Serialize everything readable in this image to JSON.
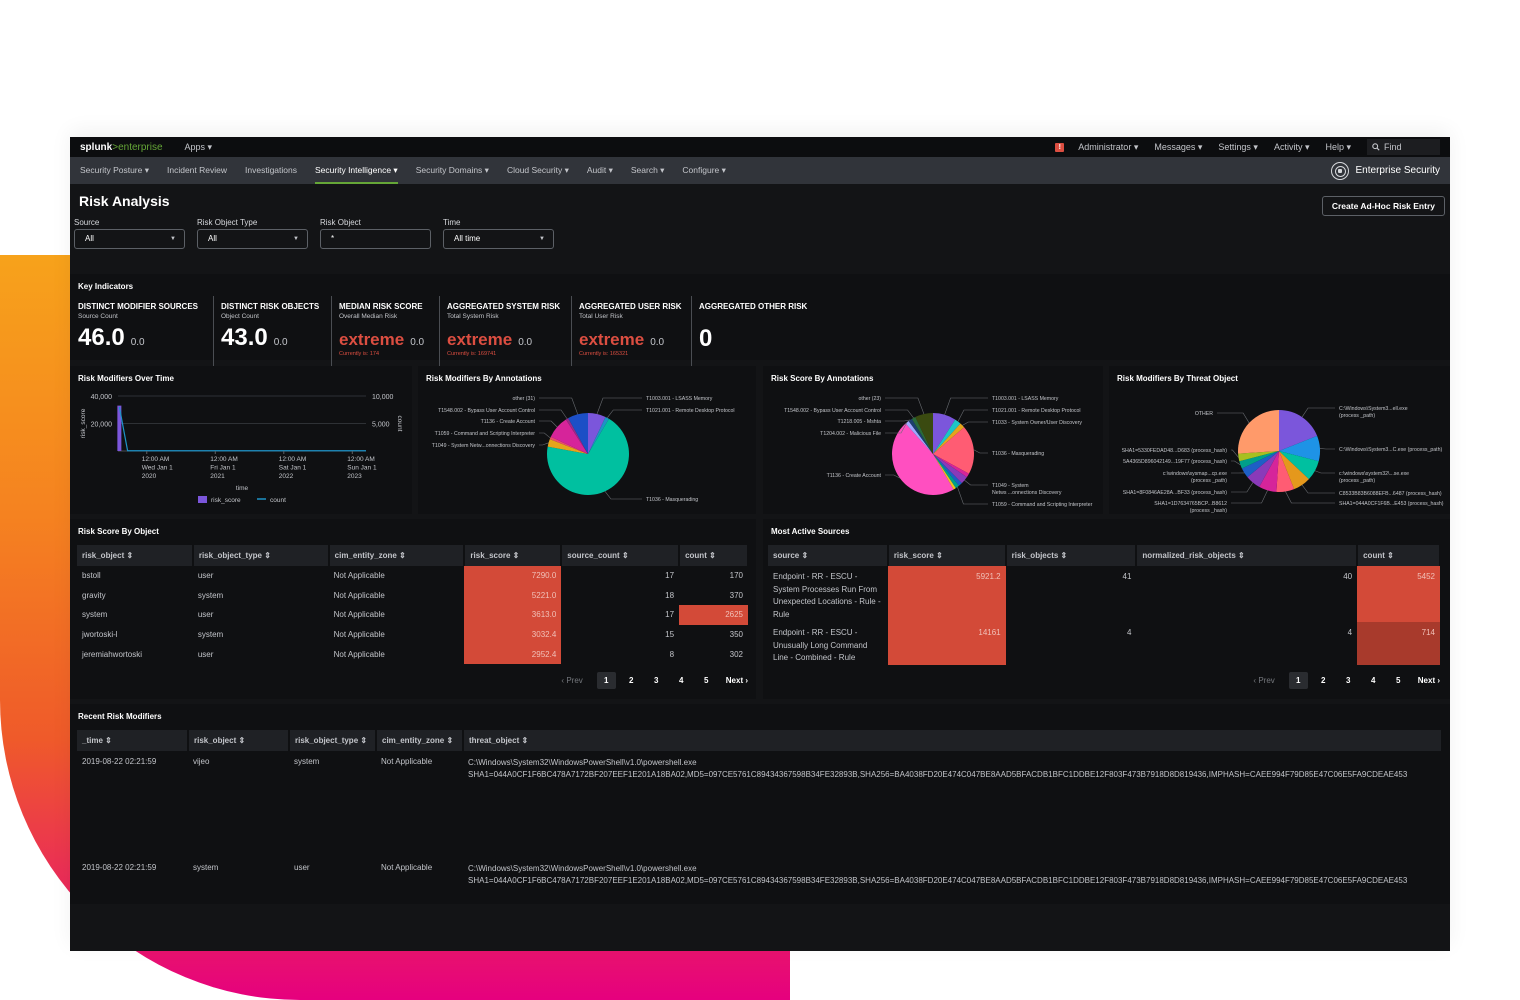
{
  "topbar": {
    "logo_main": "splunk",
    "logo_sep": ">",
    "logo_sub": "enterprise",
    "apps_label": "Apps ▾",
    "alert_badge": "!",
    "menu": [
      "Administrator ▾",
      "Messages ▾",
      "Settings ▾",
      "Activity ▾",
      "Help ▾"
    ],
    "find_placeholder": "Find"
  },
  "nav": {
    "items": [
      {
        "label": "Security Posture ▾",
        "active": false
      },
      {
        "label": "Incident Review",
        "active": false
      },
      {
        "label": "Investigations",
        "active": false
      },
      {
        "label": "Security Intelligence ▾",
        "active": true
      },
      {
        "label": "Security Domains ▾",
        "active": false
      },
      {
        "label": "Cloud Security ▾",
        "active": false
      },
      {
        "label": "Audit ▾",
        "active": false
      },
      {
        "label": "Search ▾",
        "active": false
      },
      {
        "label": "Configure ▾",
        "active": false
      }
    ],
    "brand": "Enterprise Security"
  },
  "page": {
    "title": "Risk Analysis",
    "adhoc_button": "Create Ad-Hoc Risk Entry"
  },
  "filters": [
    {
      "label": "Source",
      "value": "All",
      "type": "dropdown"
    },
    {
      "label": "Risk Object Type",
      "value": "All",
      "type": "dropdown"
    },
    {
      "label": "Risk Object",
      "value": "*",
      "type": "text"
    },
    {
      "label": "Time",
      "value": "All time",
      "type": "dropdown"
    }
  ],
  "key_indicators": {
    "title": "Key Indicators",
    "items": [
      {
        "title": "DISTINCT MODIFIER SOURCES",
        "subtitle": "Source Count",
        "value": "46.0",
        "delta": "0.0",
        "current": "",
        "severity": false
      },
      {
        "title": "DISTINCT RISK OBJECTS",
        "subtitle": "Object Count",
        "value": "43.0",
        "delta": "0.0",
        "current": "",
        "severity": false
      },
      {
        "title": "MEDIAN RISK SCORE",
        "subtitle": "Overall Median Risk",
        "value": "extreme",
        "delta": "0.0",
        "current": "Currently is: 174",
        "severity": true
      },
      {
        "title": "AGGREGATED SYSTEM RISK",
        "subtitle": "Total System Risk",
        "value": "extreme",
        "delta": "0.0",
        "current": "Currently is: 169741",
        "severity": true
      },
      {
        "title": "AGGREGATED USER RISK",
        "subtitle": "Total User Risk",
        "value": "extreme",
        "delta": "0.0",
        "current": "Currently is: 165321",
        "severity": true
      },
      {
        "title": "AGGREGATED OTHER RISK",
        "subtitle": "",
        "value": "0",
        "delta": "",
        "current": "",
        "severity": false
      }
    ]
  },
  "colors": {
    "accent_green": "#65a637",
    "severity_red": "#dc4e41",
    "heat_cell": "#d34a38",
    "risk_score_bar": "#7b56db",
    "count_line": "#1e93c6"
  },
  "chart_data": [
    {
      "type": "bar",
      "title": "Risk Modifiers Over Time",
      "xlabel": "time",
      "ylabel": "risk_score",
      "y2label": "count",
      "ylim": [
        0,
        40000
      ],
      "y2lim": [
        0,
        10000
      ],
      "yticks": [
        "40,000",
        "20,000"
      ],
      "y2ticks": [
        "10,000",
        "5,000"
      ],
      "xticks": [
        {
          "line1": "12:00 AM",
          "line2": "Wed Jan 1",
          "line3": "2020"
        },
        {
          "line1": "12:00 AM",
          "line2": "Fri Jan 1",
          "line3": "2021"
        },
        {
          "line1": "12:00 AM",
          "line2": "Sat Jan 1",
          "line3": "2022"
        },
        {
          "line1": "12:00 AM",
          "line2": "Sun Jan 1",
          "line3": "2023"
        }
      ],
      "series": [
        {
          "name": "risk_score",
          "kind": "bar",
          "x": [
            2019.6
          ],
          "values": [
            33000
          ]
        },
        {
          "name": "count",
          "kind": "line",
          "x": [
            2019.6,
            2019.72,
            2023.2
          ],
          "values": [
            8000,
            50,
            50
          ]
        }
      ],
      "xrange": [
        2019.58,
        2023.2
      ],
      "legend": [
        "risk_score",
        "count"
      ],
      "legend_position": "bottom",
      "grid": true
    },
    {
      "type": "pie",
      "title": "Risk Modifiers By Annotations",
      "slices": [
        {
          "label": "T1003.001 - LSASS Memory",
          "value": 7,
          "color": "#7b56db"
        },
        {
          "label": "T1021.001 - Remote Desktop Protocol",
          "value": 1.5,
          "color": "#1e93c6"
        },
        {
          "label": "T1036 - Masquerading",
          "value": 69,
          "color": "#00c0a0"
        },
        {
          "label": "T1049 - System Netw...onnections Discovery",
          "value": 3,
          "color": "#e5a51c"
        },
        {
          "label": "T1059 - Command and Scripting Interpreter",
          "value": 1,
          "color": "#ea4b6f"
        },
        {
          "label": "T1136 - Create Account",
          "value": 9,
          "color": "#d6249a"
        },
        {
          "label": "T1548.002 - Bypass User Account Control",
          "value": 1,
          "color": "#9b2a8a"
        },
        {
          "label": "other (31)",
          "value": 8,
          "color": "#1c4fc6"
        }
      ]
    },
    {
      "type": "pie",
      "title": "Risk Score By Annotations",
      "slices": [
        {
          "label": "T1003.001 - LSASS Memory",
          "value": 9,
          "color": "#7b56db"
        },
        {
          "label": "T1021.001 - Remote Desktop Protocol",
          "value": 2.5,
          "color": "#1cc6c6"
        },
        {
          "label": "T1033 - System Owner/User Discovery",
          "value": 2,
          "color": "#e5a51c"
        },
        {
          "label": "T1036 - Masquerading",
          "value": 19,
          "color": "#ff5c73"
        },
        {
          "label": "",
          "value": 1.5,
          "color": "#d6249a"
        },
        {
          "label": "T1049 - System Netws...onnections Discovery",
          "value": 3,
          "color": "#8a3ab9"
        },
        {
          "label": "",
          "value": 1.5,
          "color": "#1e5fc6"
        },
        {
          "label": "T1059 - Command and Scripting Interpreter",
          "value": 1.5,
          "color": "#00a08a"
        },
        {
          "label": "",
          "value": 1,
          "color": "#f0c020"
        },
        {
          "label": "T1136 - Create Account",
          "value": 46,
          "color": "#ff4fc0"
        },
        {
          "label": "T1204.002 - Malicious File",
          "value": 1.5,
          "color": "#9fa8ff"
        },
        {
          "label": "T1218.005 - Mshta",
          "value": 1.5,
          "color": "#1c3f6e"
        },
        {
          "label": "T1548.002 - Bypass User Account Control",
          "value": 1.5,
          "color": "#2a6a3a"
        },
        {
          "label": "other (23)",
          "value": 7,
          "color": "#3a4a10"
        }
      ]
    },
    {
      "type": "pie",
      "title": "Risk Modifiers By Threat Object",
      "slices": [
        {
          "label": "C:\\Windows\\System3...ell.exe (process_path)",
          "value": 19,
          "color": "#7b56db"
        },
        {
          "label": "C:\\Windows\\System3...C.exe (process_path)",
          "value": 10,
          "color": "#1e93e6"
        },
        {
          "label": "c:\\windows\\system32\\...se.exe (process_path)",
          "value": 8,
          "color": "#00c0a0"
        },
        {
          "label": "C8533B83B6088EFB...6487 (process_hash)",
          "value": 7,
          "color": "#e5981c"
        },
        {
          "label": "SHA1=044A0CF1F6B...E453 (process_hash)",
          "value": 7,
          "color": "#ff5c73"
        },
        {
          "label": "SHA1=1D7634765BCP...B8612 (process_hash)",
          "value": 7,
          "color": "#d6249a"
        },
        {
          "label": "SHA1=8F0846AE28A...BF33 (process_hash)",
          "value": 6,
          "color": "#8a3ab9"
        },
        {
          "label": "c:\\windows\\sysmap...cp.exe (process_path)",
          "value": 4,
          "color": "#1e5fc6"
        },
        {
          "label": "5A4365D896042149...19F77 (process_hash)",
          "value": 3,
          "color": "#00a08a"
        },
        {
          "label": "SHA1=5330FEDAD48...D683 (process_hash)",
          "value": 3,
          "color": "#a8c020"
        },
        {
          "label": "OTHER",
          "value": 26,
          "color": "#ff9a6a"
        }
      ]
    }
  ],
  "risk_score_by_object": {
    "title": "Risk Score By Object",
    "columns": [
      "risk_object ⇕",
      "risk_object_type ⇕",
      "cim_entity_zone ⇕",
      "risk_score ⇕",
      "source_count ⇕",
      "count ⇕"
    ],
    "rows": [
      [
        "bstoll",
        "user",
        "Not Applicable",
        "7290.0",
        "17",
        "170"
      ],
      [
        "gravity",
        "system",
        "Not Applicable",
        "5221.0",
        "18",
        "370"
      ],
      [
        "system",
        "user",
        "Not Applicable",
        "3613.0",
        "17",
        "2625"
      ],
      [
        "jwortoski-l",
        "system",
        "Not Applicable",
        "3032.4",
        "15",
        "350"
      ],
      [
        "jeremiahwortoski",
        "user",
        "Not Applicable",
        "2952.4",
        "8",
        "302"
      ]
    ],
    "pager": {
      "prev": "Prev",
      "pages": [
        "1",
        "2",
        "3",
        "4",
        "5"
      ],
      "current": "1",
      "next": "Next"
    }
  },
  "most_active_sources": {
    "title": "Most Active Sources",
    "columns": [
      "source ⇕",
      "risk_score ⇕",
      "risk_objects ⇕",
      "normalized_risk_objects ⇕",
      "count ⇕"
    ],
    "rows": [
      [
        "Endpoint - RR - ESCU - System Processes Run From Unexpected Locations - Rule - Rule",
        "5921.2",
        "41",
        "40",
        "5452"
      ],
      [
        "Endpoint - RR - ESCU - Unusually Long Command Line - Combined - Rule",
        "14161",
        "4",
        "4",
        "714"
      ]
    ],
    "pager": {
      "prev": "Prev",
      "pages": [
        "1",
        "2",
        "3",
        "4",
        "5"
      ],
      "current": "1",
      "next": "Next"
    }
  },
  "recent_risk_modifiers": {
    "title": "Recent Risk Modifiers",
    "columns": [
      "_time ⇕",
      "risk_object ⇕",
      "risk_object_type ⇕",
      "cim_entity_zone ⇕",
      "threat_object ⇕"
    ],
    "rows": [
      {
        "time": "2019-08-22 02:21:59",
        "risk_object": "vijeo",
        "risk_object_type": "system",
        "cim_entity_zone": "Not Applicable",
        "threat_path": "C:\\Windows\\System32\\WindowsPowerShell\\v1.0\\powershell.exe",
        "threat_hash": "SHA1=044A0CF1F6BC478A7172BF207EEF1E201A18BA02,MD5=097CE5761C89434367598B34FE32893B,SHA256=BA4038FD20E474C047BE8AAD5BFACDB1BFC1DDBE12F803F473B7918D8D819436,IMPHASH=CAEE994F79D85E47C06E5FA9CDEAE453"
      },
      {
        "time": "2019-08-22 02:21:59",
        "risk_object": "system",
        "risk_object_type": "user",
        "cim_entity_zone": "Not Applicable",
        "threat_path": "C:\\Windows\\System32\\WindowsPowerShell\\v1.0\\powershell.exe",
        "threat_hash": "SHA1=044A0CF1F6BC478A7172BF207EEF1E201A18BA02,MD5=097CE5761C89434367598B34FE32893B,SHA256=BA4038FD20E474C047BE8AAD5BFACDB1BFC1DDBE12F803F473B7918D8D819436,IMPHASH=CAEE994F79D85E47C06E5FA9CDEAE453"
      }
    ]
  }
}
